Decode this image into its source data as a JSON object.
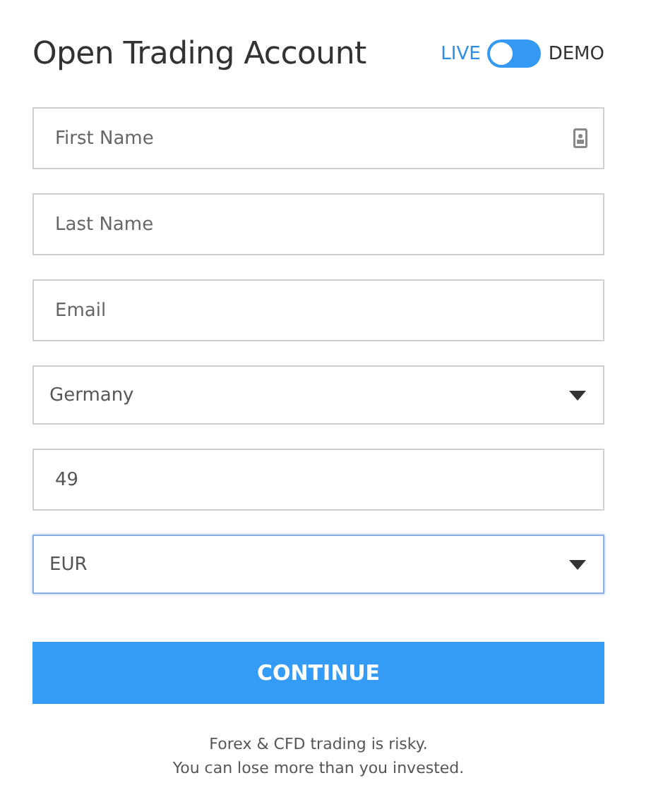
{
  "title": "Open Trading Account",
  "mode_switch": {
    "left_label": "LIVE",
    "right_label": "DEMO",
    "on": false
  },
  "fields": [
    {
      "kind": "text",
      "placeholder": "First Name",
      "autofill": true,
      "focused": false
    },
    {
      "kind": "text",
      "placeholder": "Last Name",
      "autofill": false,
      "focused": false
    },
    {
      "kind": "text",
      "placeholder": "Email",
      "autofill": false,
      "focused": false
    },
    {
      "kind": "select",
      "value": "Germany",
      "autofill": false,
      "focused": false
    },
    {
      "kind": "text",
      "value": "49",
      "autofill": false,
      "focused": false
    },
    {
      "kind": "select",
      "value": "EUR",
      "autofill": false,
      "focused": true
    }
  ],
  "submit": "CONTINUE",
  "disclaimer": [
    "Forex & CFD trading is risky.",
    "You can lose more than you invested."
  ]
}
